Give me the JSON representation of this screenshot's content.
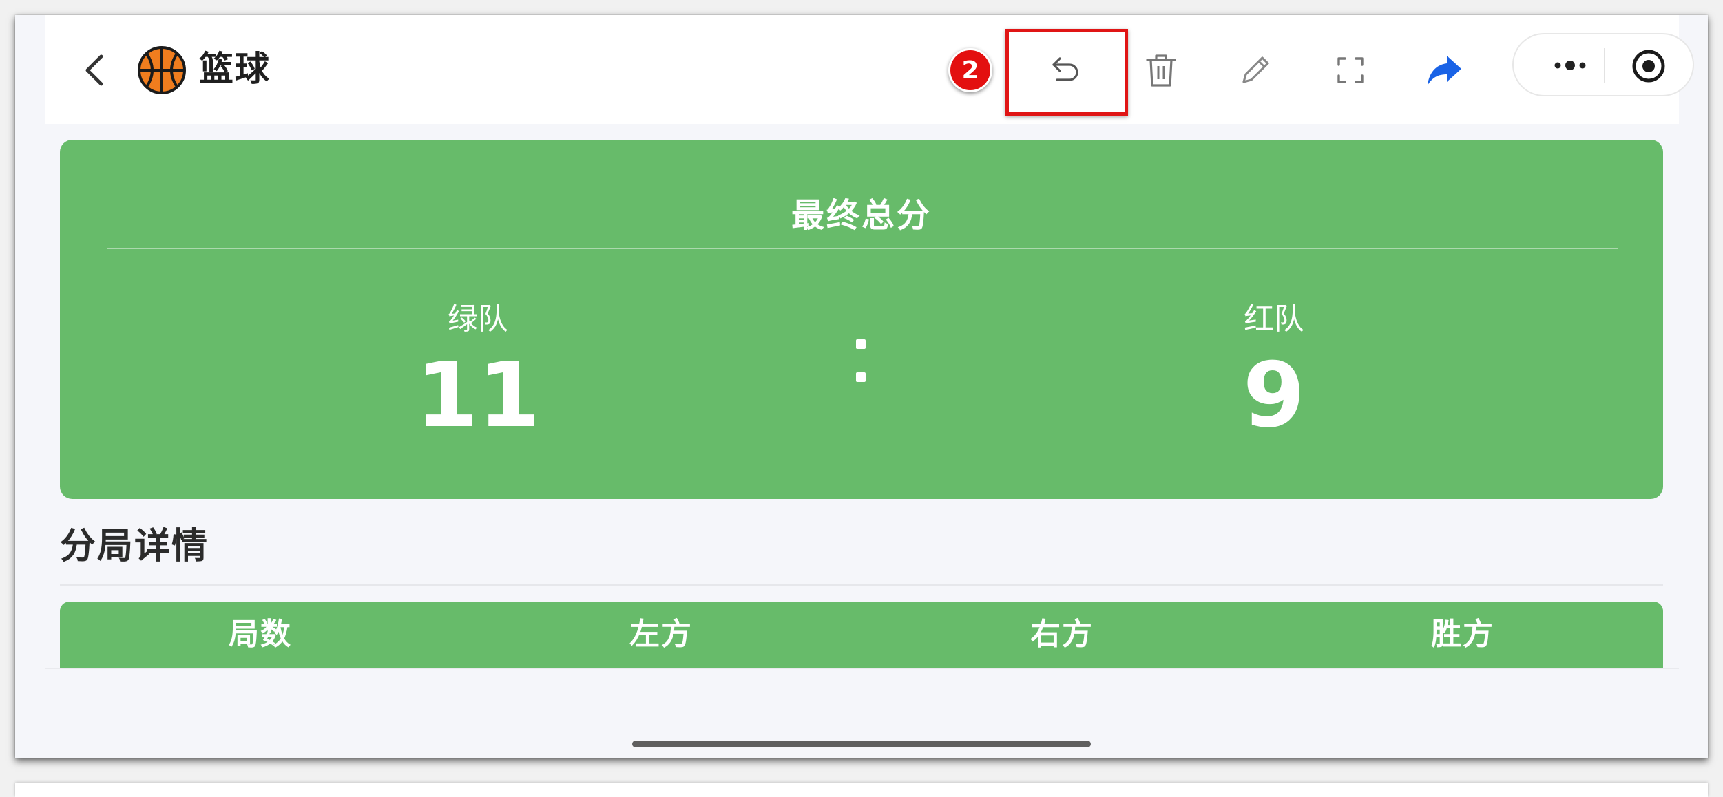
{
  "header": {
    "back_icon": "chevron-left-icon",
    "logo_icon": "basketball-icon",
    "title": "篮球",
    "step_badge": "2",
    "toolbar_icons": [
      "undo-icon",
      "trash-icon",
      "pencil-icon",
      "fullscreen-icon",
      "share-icon"
    ],
    "capsule_icons": [
      "more-icon",
      "target-icon"
    ]
  },
  "score_card": {
    "title": "最终总分",
    "left_team": {
      "name": "绿队",
      "score": "11"
    },
    "right_team": {
      "name": "红队",
      "score": "9"
    },
    "card_color": "#67bb6a"
  },
  "rounds": {
    "title": "分局详情",
    "columns": [
      "局数",
      "左方",
      "右方",
      "胜方"
    ]
  },
  "colors": {
    "accent_green": "#67bb6a",
    "share_blue": "#1a63e6",
    "annotation_red": "#e01515"
  }
}
